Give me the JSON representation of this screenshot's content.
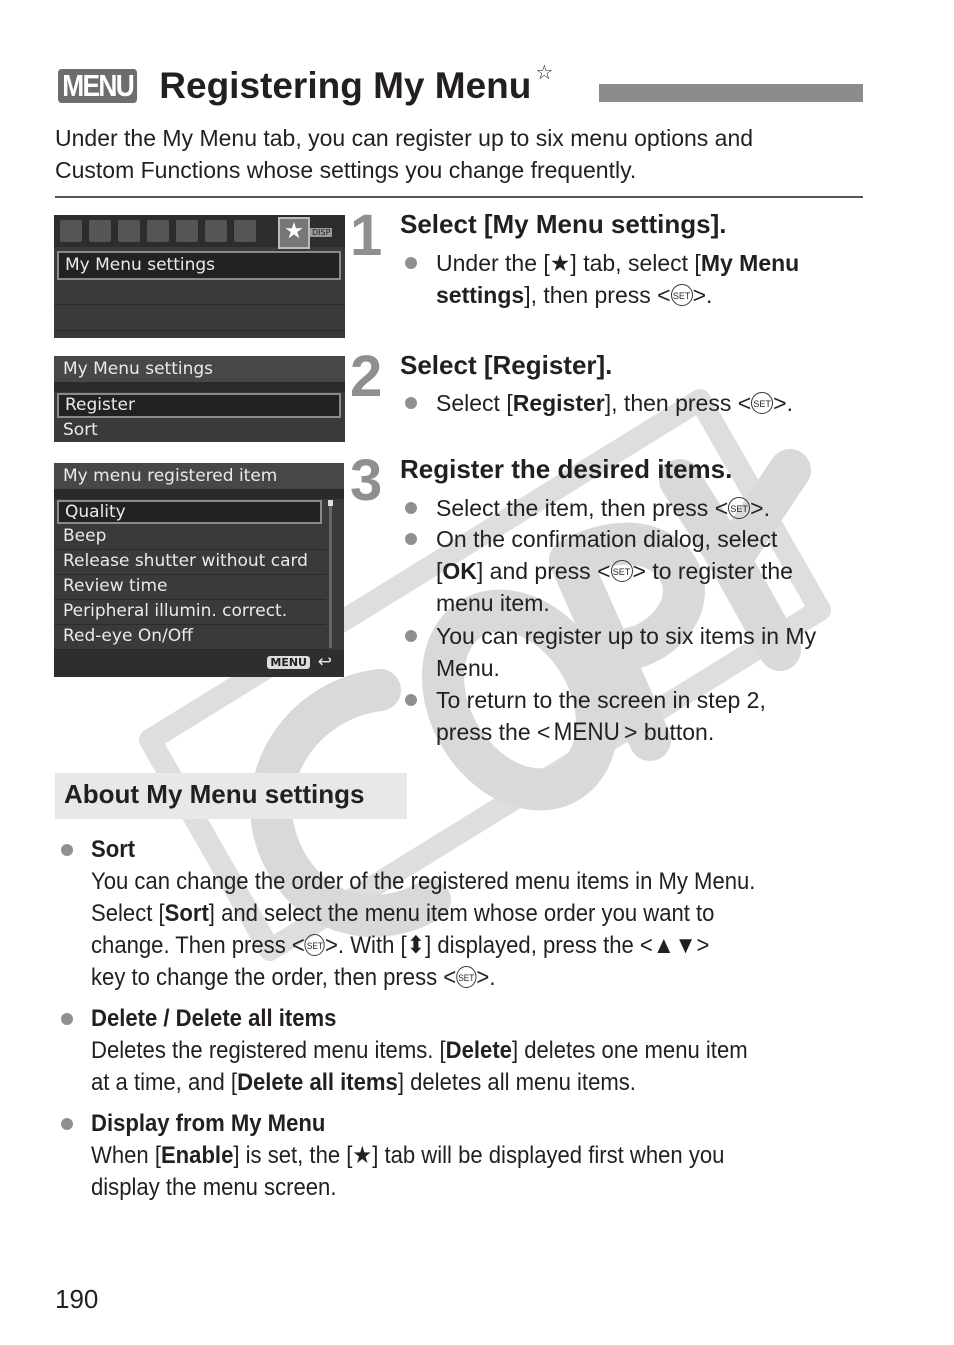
{
  "header": {
    "menu_badge": "MENU",
    "title": "Registering My Menu",
    "title_star": "☆"
  },
  "intro": "Under the My Menu tab, you can register up to six menu options and Custom Functions whose settings you change frequently.",
  "intro_lines": [
    "Under the My Menu tab, you can register up to six menu options and",
    "Custom Functions whose settings you change frequently."
  ],
  "screens": {
    "screen1": {
      "active_tab_icon": "★",
      "disp_label": "DISP",
      "rows": [
        "My Menu settings"
      ]
    },
    "screen2": {
      "header": "My Menu settings",
      "rows": [
        "Register",
        "Sort"
      ]
    },
    "screen3": {
      "header": "My menu registered item",
      "rows": [
        "Quality",
        "Beep",
        "Release shutter without card",
        "Review time",
        "Peripheral illumin. correct.",
        "Red-eye On/Off"
      ],
      "footer_button": "MENU",
      "footer_icon": "↩"
    }
  },
  "steps": [
    {
      "number": "1",
      "title": "Select [My Menu settings].",
      "bullets": [
        {
          "parts": [
            "Under the [",
            "★",
            "] tab, select [",
            "My Menu",
            "settings",
            "], then press <",
            "SET",
            ">."
          ]
        }
      ]
    },
    {
      "number": "2",
      "title": "Select [Register].",
      "bullets": [
        {
          "parts": [
            "Select [",
            "Register",
            "], then press <",
            "SET",
            ">."
          ]
        }
      ]
    },
    {
      "number": "3",
      "title": "Register the desired items.",
      "bullets": [
        {
          "parts": [
            "Select the item, then press <",
            "SET",
            ">."
          ]
        },
        {
          "parts": [
            "On the confirmation dialog, select",
            "[",
            "OK",
            "] and press <",
            "SET",
            "> to register the",
            "menu item."
          ]
        },
        {
          "parts": [
            "You can register up to six items in My",
            "Menu."
          ]
        },
        {
          "parts": [
            "To return to the screen in step 2,",
            "press the <",
            "MENU",
            "> button."
          ]
        }
      ]
    }
  ],
  "about": {
    "heading": "About My Menu settings",
    "sections": [
      {
        "title": "Sort",
        "lines": [
          [
            "You can change the order of the registered menu items in My Menu."
          ],
          [
            "Select [",
            "Sort",
            "] and select the menu item whose order you want to"
          ],
          [
            "change. Then press <",
            "SET",
            ">. With [",
            "⬍",
            "] displayed, press the <",
            "▲▼",
            ">"
          ],
          [
            "key to change the order, then press <",
            "SET",
            ">."
          ]
        ]
      },
      {
        "title": "Delete / Delete all items",
        "lines": [
          [
            "Deletes the registered menu items. [",
            "Delete",
            "] deletes one menu item"
          ],
          [
            "at a time, and [",
            "Delete all items",
            "] deletes all menu items."
          ]
        ]
      },
      {
        "title": "Display from My Menu",
        "lines": [
          [
            "When [",
            "Enable",
            "] is set, the [",
            "★",
            "] tab will be displayed first when you"
          ],
          [
            "display the menu screen."
          ]
        ]
      }
    ]
  },
  "watermark": "COPY",
  "page_number": "190",
  "colors": {
    "title_bar": "#8c8c8c",
    "badge": "#6d6d6d",
    "bullet": "#909090",
    "step_number": "#8f8f8f",
    "about_bg": "#e8e8e8",
    "watermark": "#dcdcdc"
  }
}
